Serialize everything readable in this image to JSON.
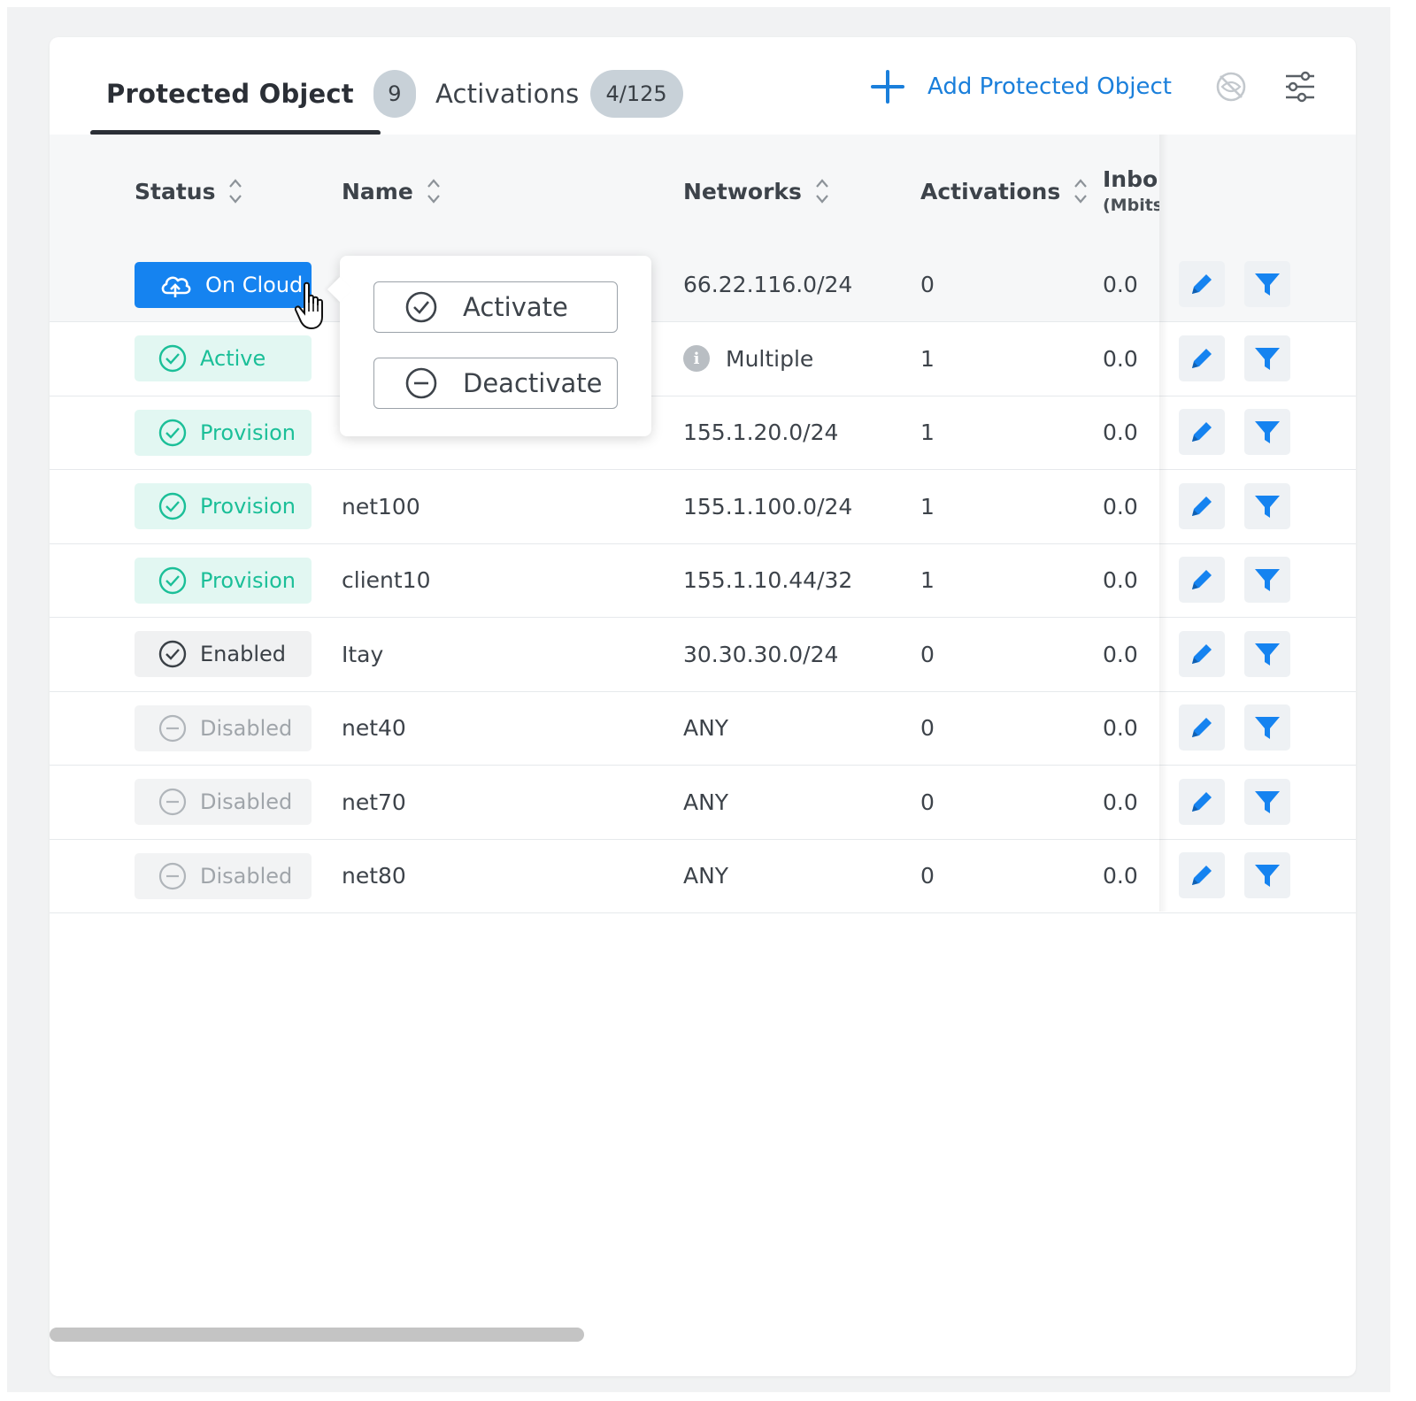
{
  "tabs": [
    {
      "label": "Protected Object",
      "count": "9",
      "active": true
    },
    {
      "label": "Activations",
      "count": "4/125",
      "active": false
    }
  ],
  "toolbar": {
    "add_label": "Add Protected Object",
    "icons": [
      "eye-off-icon",
      "sliders-icon"
    ]
  },
  "table": {
    "columns": [
      {
        "label": "Status",
        "sortable": true
      },
      {
        "label": "Name",
        "sortable": true
      },
      {
        "label": "Networks",
        "sortable": true
      },
      {
        "label": "Activations",
        "sortable": true
      },
      {
        "label": "Inbou",
        "sub": "(Mbits",
        "sortable": false
      }
    ],
    "rows": [
      {
        "status": "On Cloud",
        "name": "",
        "network": "66.22.116.0/24",
        "activations": "0",
        "inbound": "0.0"
      },
      {
        "status": "Active",
        "name": "",
        "network": "Multiple",
        "activations": "1",
        "inbound": "0.0"
      },
      {
        "status": "Provision",
        "name": "",
        "network": "155.1.20.0/24",
        "activations": "1",
        "inbound": "0.0"
      },
      {
        "status": "Provision",
        "name": "net100",
        "network": "155.1.100.0/24",
        "activations": "1",
        "inbound": "0.0"
      },
      {
        "status": "Provision",
        "name": "client10",
        "network": "155.1.10.44/32",
        "activations": "1",
        "inbound": "0.0"
      },
      {
        "status": "Enabled",
        "name": "Itay",
        "network": "30.30.30.0/24",
        "activations": "0",
        "inbound": "0.0"
      },
      {
        "status": "Disabled",
        "name": "net40",
        "network": "ANY",
        "activations": "0",
        "inbound": "0.0"
      },
      {
        "status": "Disabled",
        "name": "net70",
        "network": "ANY",
        "activations": "0",
        "inbound": "0.0"
      },
      {
        "status": "Disabled",
        "name": "net80",
        "network": "ANY",
        "activations": "0",
        "inbound": "0.0"
      }
    ]
  },
  "popup": {
    "activate_label": "Activate",
    "deactivate_label": "Deactivate"
  },
  "colors": {
    "accent": "#1583f0",
    "link": "#1a7fdb",
    "provision_text": "#1bbf98",
    "provision_bg": "#e2f7f2"
  }
}
